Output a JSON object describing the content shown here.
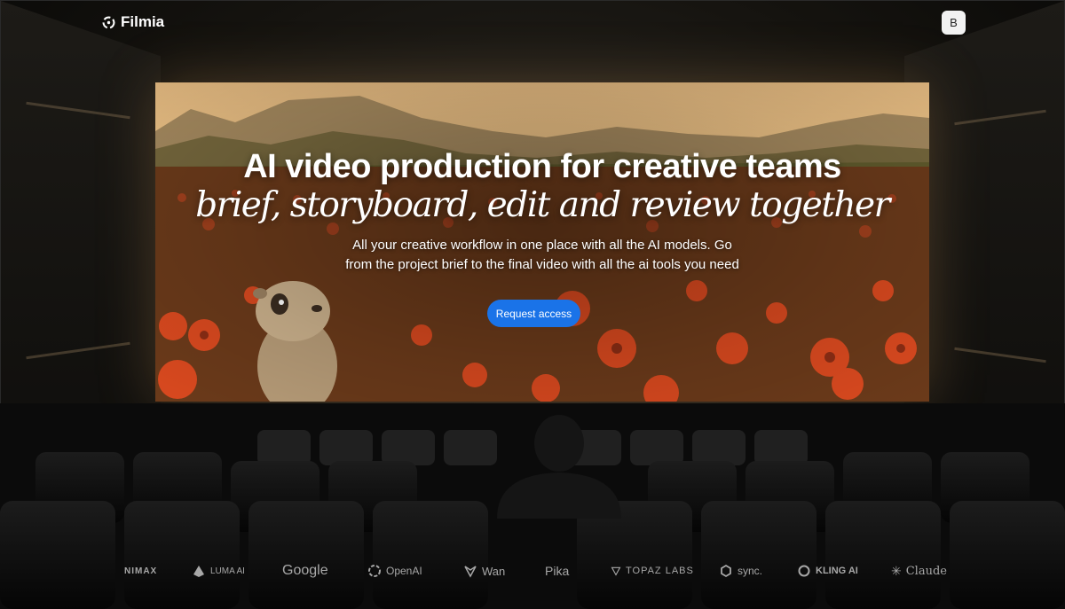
{
  "brand": {
    "name": "Filmia",
    "icon": "filmia-logo-icon"
  },
  "user": {
    "avatar_initial": "B"
  },
  "hero": {
    "title": "AI video production for creative teams",
    "subtitle": "brief, storyboard, edit and review together",
    "description_line1": "All your creative workflow in one place with all the AI models. Go",
    "description_line2": "from the project brief to the final video with all the ai tools you need",
    "cta_label": "Request access"
  },
  "partners": [
    {
      "label": "NIMAX",
      "icon": ""
    },
    {
      "label": "LUMA AI",
      "icon": "luma-icon"
    },
    {
      "label": "Google",
      "icon": ""
    },
    {
      "label": "OpenAI",
      "icon": "openai-icon"
    },
    {
      "label": "Wan",
      "icon": "wan-icon"
    },
    {
      "label": "Pika",
      "icon": ""
    },
    {
      "label": "TOPAZ LABS",
      "icon": "topaz-icon"
    },
    {
      "label": "sync.",
      "icon": "sync-icon"
    },
    {
      "label": "KLING AI",
      "icon": "kling-icon"
    },
    {
      "label": "Claude",
      "icon": "claude-icon"
    }
  ],
  "colors": {
    "cta": "#1a73e8",
    "text": "#ffffff",
    "partner_text": "#a8a8a8"
  }
}
